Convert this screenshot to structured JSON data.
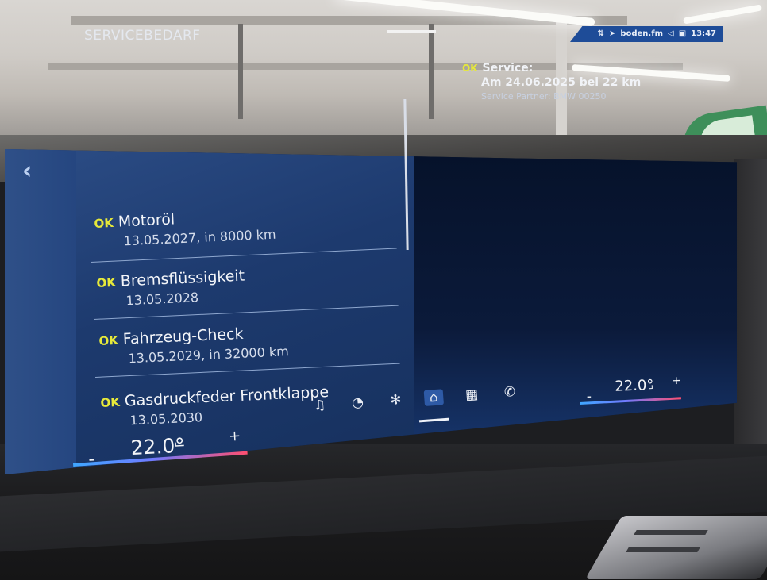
{
  "panel": {
    "title": "SERVICEBEDARF",
    "items": [
      {
        "status": "OK",
        "title": "Motoröl",
        "detail": "13.05.2027, in 8000 km"
      },
      {
        "status": "OK",
        "title": "Bremsflüssigkeit",
        "detail": "13.05.2028"
      },
      {
        "status": "OK",
        "title": "Fahrzeug-Check",
        "detail": "13.05.2029, in 32000 km"
      },
      {
        "status": "OK",
        "title": "Gasdruckfeder Frontklappe",
        "detail": "13.05.2030"
      }
    ]
  },
  "detail": {
    "status": "OK",
    "title": "Service:",
    "date_line": "Am 24.06.2025 bei 22 km",
    "partner": "Service Partner: BMW 00250"
  },
  "status_bar": {
    "station": "boden.fm",
    "time": "13:47"
  },
  "climate": {
    "left": {
      "minus": "-",
      "temp": "22.0°",
      "plus": "+"
    },
    "right": {
      "minus": "-",
      "temp": "22.0°",
      "plus": "+"
    }
  },
  "nav": {
    "items": [
      {
        "icon": "music-icon",
        "glyph": "♫"
      },
      {
        "icon": "gauge-icon",
        "glyph": "◔"
      },
      {
        "icon": "fan-icon",
        "glyph": "✻"
      },
      {
        "icon": "home-icon",
        "glyph": "⌂"
      },
      {
        "icon": "apps-grid-icon",
        "glyph": "▦"
      },
      {
        "icon": "phone-icon",
        "glyph": "✆"
      }
    ],
    "active": "home-icon"
  },
  "colors": {
    "ok": "#e6e93a",
    "panel_blue": "#1d3a6e",
    "accent": "#1e4c98"
  }
}
